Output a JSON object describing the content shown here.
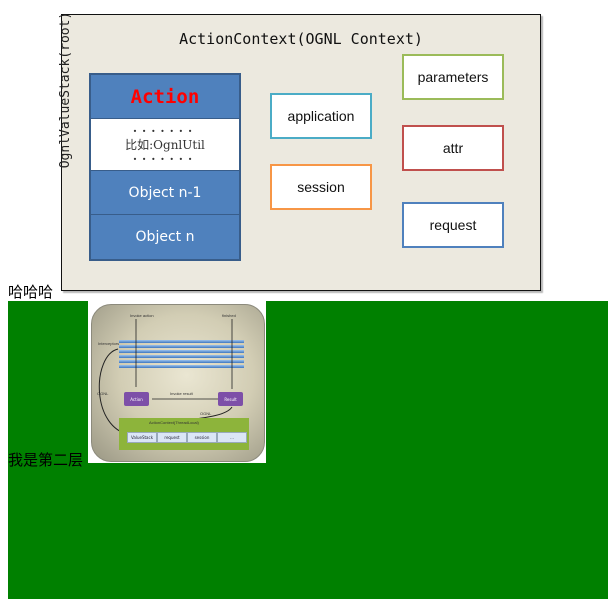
{
  "diagram": {
    "title": "ActionContext(OGNL Context)",
    "stack_label": "OgnlValueStack(root)",
    "stack": {
      "top": "Action",
      "dots_top": "·······",
      "util": "比如:OgnlUtil",
      "dots_bottom": "·······",
      "object_n1": "Object n-1",
      "object_n": "Object n"
    },
    "boxes": {
      "application": "application",
      "session": "session",
      "parameters": "parameters",
      "attr": "attr",
      "request": "request"
    },
    "colors": {
      "background": "#ece9df",
      "stack_fill": "#4f81bd",
      "action_text": "#ff0000",
      "application_border": "#4bacc6",
      "session_border": "#f79646",
      "parameters_border": "#9bbb59",
      "attr_border": "#c0504d",
      "request_border": "#4f81bd"
    }
  },
  "text_hahaha": "哈哈哈",
  "layer2": {
    "label": "我是第二层",
    "background": "#008000",
    "flow_image": {
      "invoke_action": "Invoke action",
      "finished": "finished",
      "interceptors": "Interceptors",
      "ognl_left": "OGNL",
      "action": "Action",
      "invoke_result": "Invoke result",
      "result": "Result",
      "ognl_right": "OGNL",
      "context_title": "ActionContext(ThreadLocal)",
      "slots": [
        "ValueStack",
        "request",
        "session",
        "..."
      ]
    }
  }
}
